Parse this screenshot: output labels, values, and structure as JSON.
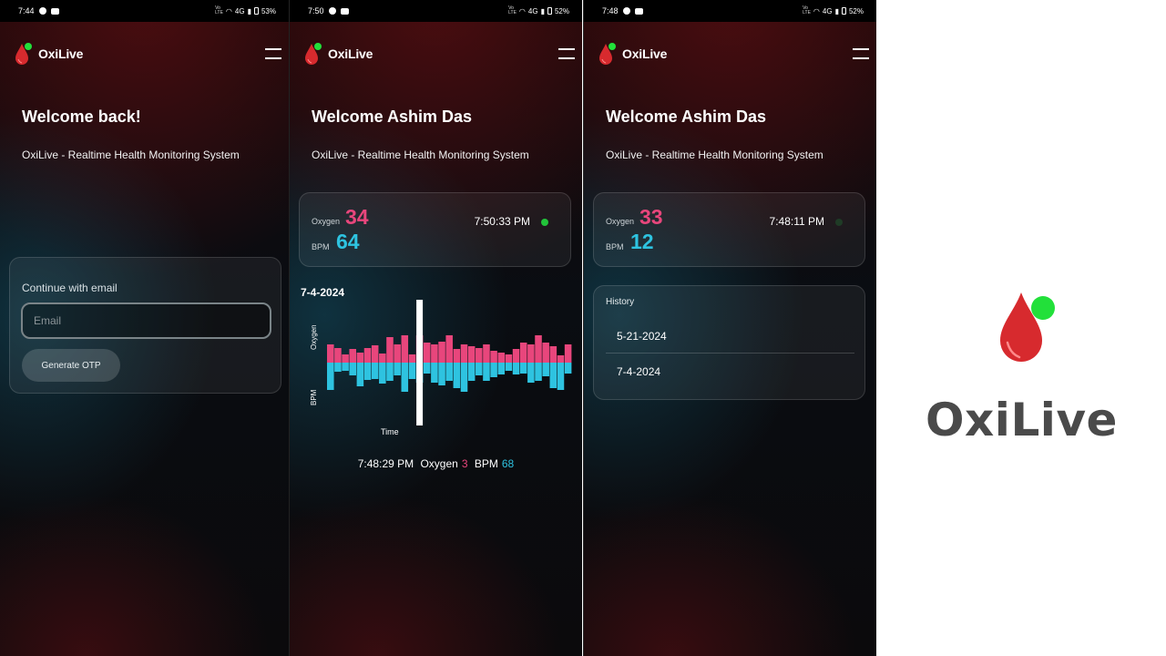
{
  "app": {
    "name": "OxiLive",
    "subtitle": "OxiLive - Realtime Health Monitoring System"
  },
  "colors": {
    "oxygen": "#e8467c",
    "bpm": "#2ec3e0",
    "drop": "#d72a2e",
    "status_green": "#22c33a"
  },
  "screens": [
    {
      "status": {
        "time": "7:44",
        "net": "4G",
        "battery": "53%"
      },
      "title": "Welcome back!",
      "login": {
        "label": "Continue with email",
        "email_placeholder": "Email",
        "email_value": "",
        "button": "Generate OTP"
      }
    },
    {
      "status": {
        "time": "7:50",
        "net": "4G",
        "battery": "52%"
      },
      "title": "Welcome Ashim Das",
      "reading": {
        "oxygen_label": "Oxygen",
        "oxygen_value": "34",
        "bpm_label": "BPM",
        "bpm_value": "64",
        "time": "7:50:33 PM"
      },
      "chart_date": "7-4-2024",
      "readout": {
        "time": "7:48:29 PM",
        "oxygen_label": "Oxygen",
        "oxygen_value": "3",
        "bpm_label": "BPM",
        "bpm_value": "68"
      }
    },
    {
      "status": {
        "time": "7:48",
        "net": "4G",
        "battery": "52%"
      },
      "title": "Welcome Ashim Das",
      "reading": {
        "oxygen_label": "Oxygen",
        "oxygen_value": "33",
        "bpm_label": "BPM",
        "bpm_value": "12",
        "time": "7:48:11 PM"
      },
      "history": {
        "title": "History",
        "items": [
          "5-21-2024",
          "7-4-2024"
        ]
      }
    }
  ],
  "chart_data": {
    "type": "bar",
    "xlabel": "Time",
    "ylabel_top": "Oxygen",
    "ylabel_bottom": "BPM",
    "selected_index": 12,
    "series": [
      {
        "name": "Oxygen",
        "values": [
          20,
          16,
          9,
          15,
          11,
          16,
          19,
          10,
          28,
          20,
          30,
          9,
          30,
          22,
          20,
          23,
          30,
          15,
          20,
          18,
          16,
          20,
          13,
          11,
          9,
          15,
          22,
          20,
          30,
          22,
          18,
          8,
          20
        ]
      },
      {
        "name": "BPM",
        "values": [
          30,
          10,
          9,
          14,
          26,
          19,
          18,
          23,
          20,
          14,
          32,
          18,
          22,
          12,
          22,
          25,
          20,
          28,
          32,
          20,
          14,
          20,
          16,
          13,
          9,
          13,
          12,
          22,
          20,
          15,
          28,
          30,
          12
        ]
      }
    ]
  }
}
